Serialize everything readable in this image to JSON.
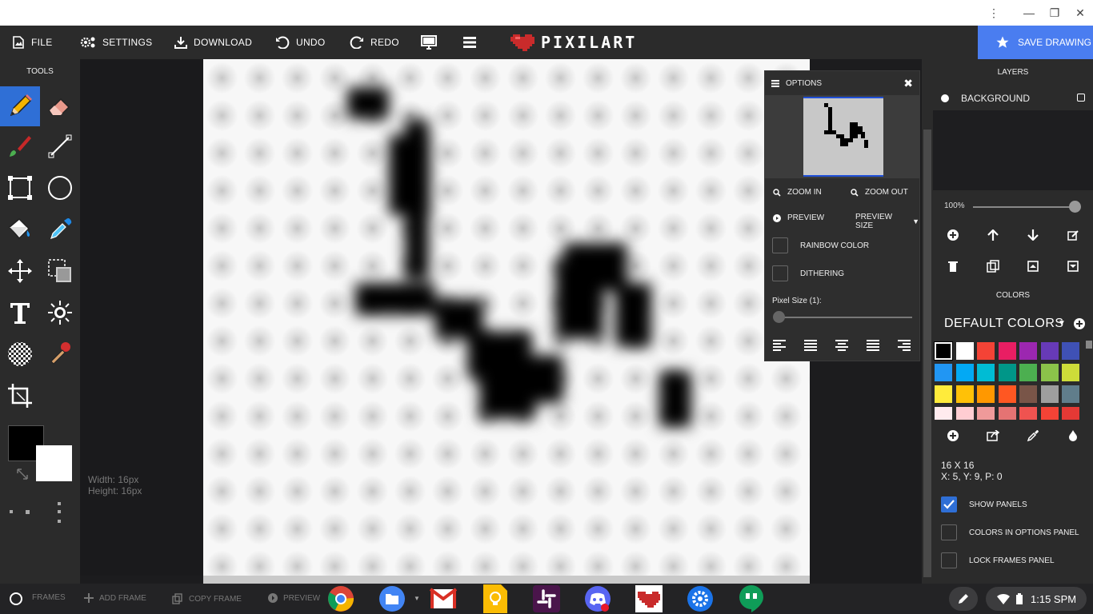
{
  "system_bar": {
    "menu_icon": "vertical-dots-icon",
    "minimize_icon": "minimize-icon",
    "restore_icon": "restore-icon",
    "close_icon": "close-icon"
  },
  "toolbar": {
    "file_label": "FILE",
    "settings_label": "SETTINGS",
    "download_label": "DOWNLOAD",
    "undo_label": "UNDO",
    "redo_label": "REDO",
    "logo_text": "PIXILART",
    "save_label": "SAVE DRAWING"
  },
  "tools": {
    "title": "TOOLS",
    "primary_color": "#000000",
    "secondary_color": "#ffffff"
  },
  "canvas": {
    "width_text": "Width: 16px",
    "height_text": "Height: 16px"
  },
  "options": {
    "title": "OPTIONS",
    "zoom_in": "ZOOM IN",
    "zoom_out": "ZOOM OUT",
    "preview": "PREVIEW",
    "preview_size": "PREVIEW SIZE",
    "rainbow_color": "RAINBOW COLOR",
    "dithering": "DITHERING",
    "pixel_size": "Pixel Size (1):"
  },
  "layers": {
    "title": "LAYERS",
    "items": [
      {
        "name": "BACKGROUND"
      }
    ],
    "zoom_value": "100%",
    "zoom_fraction": 1.0
  },
  "colors": {
    "title": "COLORS",
    "palette_name": "DEFAULT COLORS",
    "swatches": [
      "#000000",
      "#ffffff",
      "#f44336",
      "#e91e63",
      "#9c27b0",
      "#673ab7",
      "#3f51b5",
      "#2196f3",
      "#03a9f4",
      "#00bcd4",
      "#009688",
      "#4caf50",
      "#8bc34a",
      "#cddc39",
      "#ffeb3b",
      "#ffc107",
      "#ff9800",
      "#ff5722",
      "#795548",
      "#9e9e9e",
      "#607d8b",
      "#ffebee",
      "#ffcdd2",
      "#ef9a9a",
      "#e57373",
      "#ef5350",
      "#f44336",
      "#e53935"
    ]
  },
  "info": {
    "dimensions": "16 X 16",
    "cursor": "X: 5, Y: 9, P: 0"
  },
  "panel_settings": {
    "show_panels": "SHOW PANELS",
    "colors_in_options": "COLORS IN OPTIONS PANEL",
    "lock_frames": "LOCK FRAMES PANEL"
  },
  "frames_bar": {
    "frames": "FRAMES",
    "add_frame": "ADD FRAME",
    "copy_frame": "COPY FRAME",
    "preview": "PREVIEW"
  },
  "shelf": {
    "apps": [
      "chrome-icon",
      "files-icon",
      "gmail-icon",
      "keep-icon",
      "slack-icon",
      "discord-icon",
      "pixilart-icon",
      "settings-icon",
      "hangouts-icon"
    ],
    "time": "1:15 SPM"
  }
}
